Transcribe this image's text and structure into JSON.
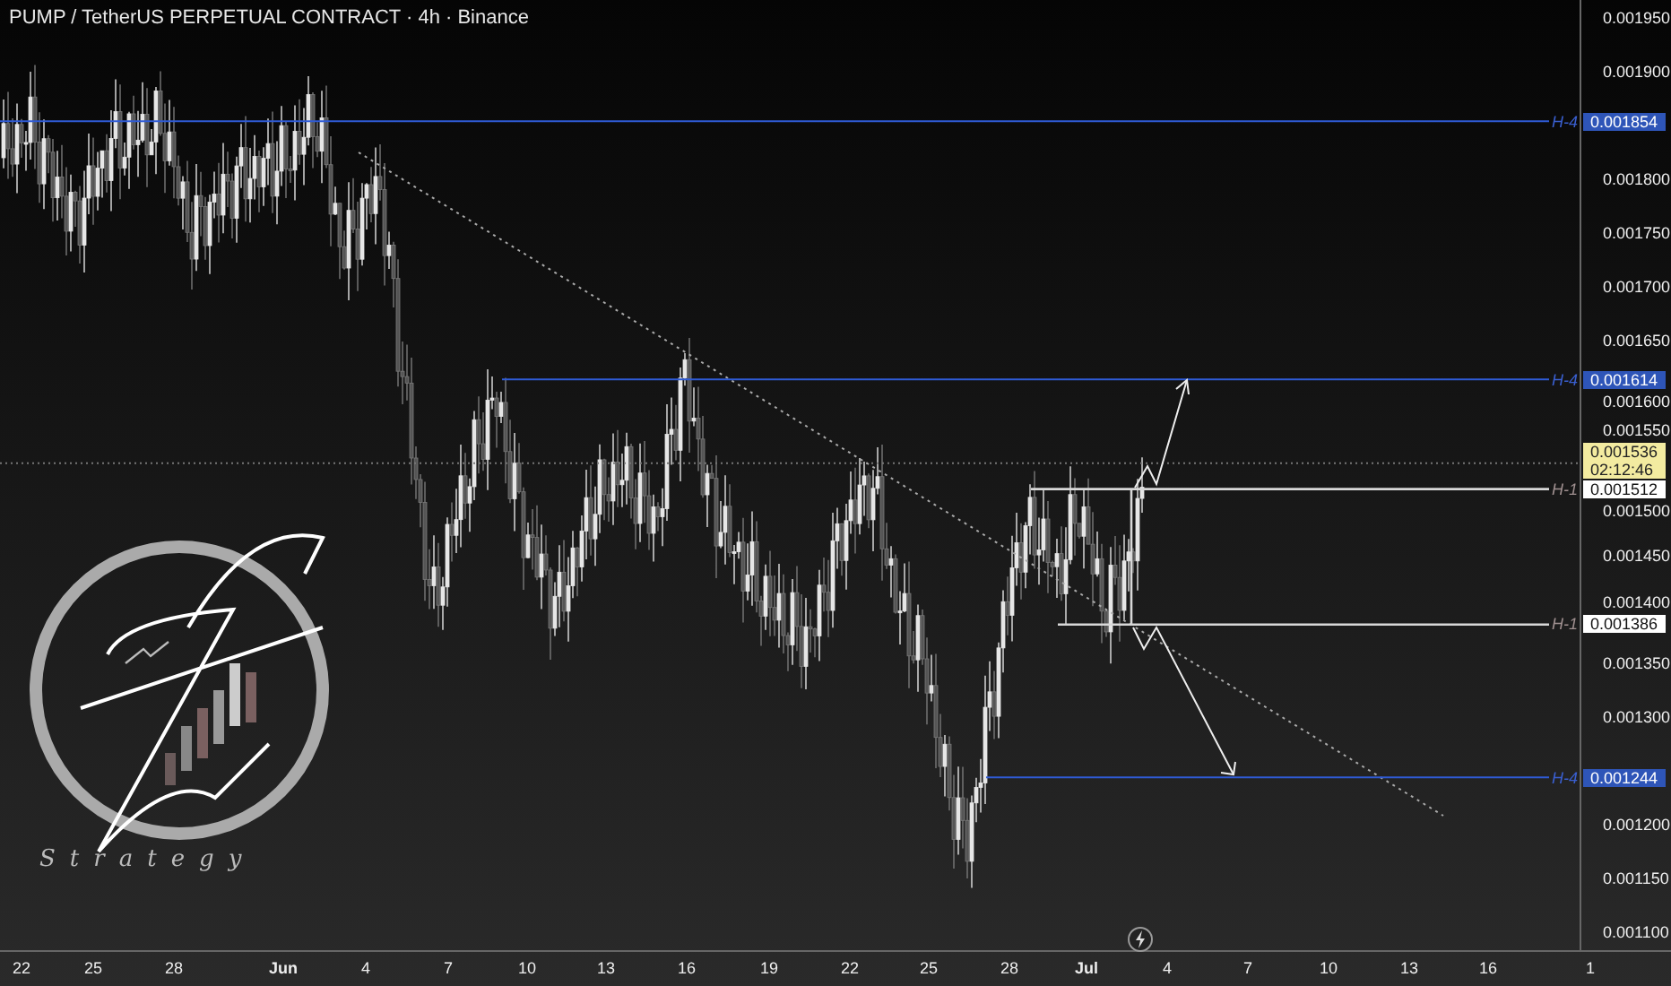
{
  "chart": {
    "title": "PUMP / TetherUS PERPETUAL CONTRACT · 4h · Binance",
    "price_axis": [
      "0.001950",
      "0.001900",
      "0.001800",
      "0.001750",
      "0.001700",
      "0.001650",
      "0.001600",
      "0.001550",
      "0.001500",
      "0.001450",
      "0.001400",
      "0.001350",
      "0.001300",
      "0.001200",
      "0.001150",
      "0.001100"
    ],
    "levels": [
      {
        "tag": "H-4",
        "price": "0.001854",
        "kind": "h4"
      },
      {
        "tag": "H-4",
        "price": "0.001614",
        "kind": "h4"
      },
      {
        "tag": "H-1",
        "price": "0.001512",
        "kind": "h1"
      },
      {
        "tag": "H-1",
        "price": "0.001386",
        "kind": "h1"
      },
      {
        "tag": "H-4",
        "price": "0.001244",
        "kind": "h4"
      }
    ],
    "last_price": {
      "price": "0.001536",
      "countdown": "02:12:46"
    },
    "time_axis": [
      "22",
      "25",
      "28",
      "Jun",
      "4",
      "7",
      "10",
      "13",
      "16",
      "19",
      "22",
      "25",
      "28",
      "Jul",
      "4",
      "7",
      "10",
      "13",
      "16",
      "1"
    ],
    "logo": {
      "text": "Strategy"
    }
  }
}
